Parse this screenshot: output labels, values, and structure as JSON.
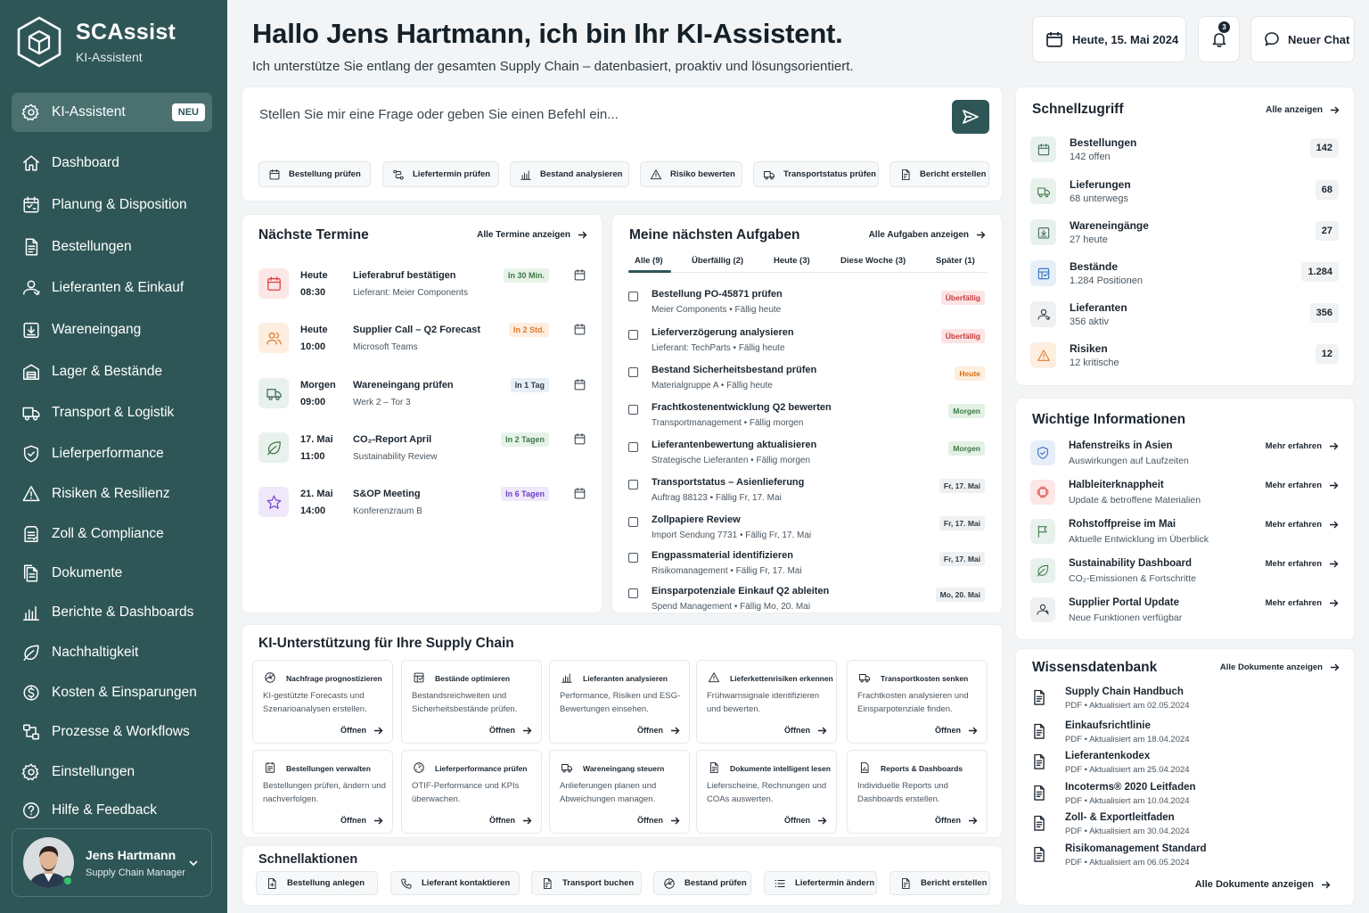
{
  "brand": {
    "name": "SCAssist",
    "subtitle": "KI-Assistent"
  },
  "nav": [
    {
      "label": "KI-Assistent",
      "icon": "gear-sparkle-icon",
      "active": true,
      "badge": "NEU"
    },
    {
      "label": "Dashboard",
      "icon": "home-icon"
    },
    {
      "label": "Planung & Disposition",
      "icon": "calendar-plan-icon"
    },
    {
      "label": "Bestellungen",
      "icon": "document-icon"
    },
    {
      "label": "Lieferanten & Einkauf",
      "icon": "supplier-icon"
    },
    {
      "label": "Wareneingang",
      "icon": "inbound-icon"
    },
    {
      "label": "Lager & Bestände",
      "icon": "warehouse-icon"
    },
    {
      "label": "Transport & Logistik",
      "icon": "truck-icon"
    },
    {
      "label": "Lieferperformance",
      "icon": "shield-check-icon"
    },
    {
      "label": "Risiken & Resilienz",
      "icon": "risk-icon"
    },
    {
      "label": "Zoll & Compliance",
      "icon": "customs-icon"
    },
    {
      "label": "Dokumente",
      "icon": "documents-icon"
    },
    {
      "label": "Berichte & Dashboards",
      "icon": "bar-chart-icon"
    },
    {
      "label": "Nachhaltigkeit",
      "icon": "leaf-icon"
    },
    {
      "label": "Kosten & Einsparungen",
      "icon": "cost-icon"
    },
    {
      "label": "Prozesse & Workflows",
      "icon": "workflow-icon"
    },
    {
      "label": "Einstellungen",
      "icon": "settings-icon"
    },
    {
      "label": "Hilfe & Feedback",
      "icon": "help-icon"
    }
  ],
  "user": {
    "name": "Jens Hartmann",
    "role": "Supply Chain Manager"
  },
  "header": {
    "title": "Hallo Jens Hartmann, ich bin Ihr KI-Assistent.",
    "subtitle": "Ich unterstütze Sie entlang der gesamten Supply Chain – datenbasiert, proaktiv und lösungsorientiert.",
    "date": "Heute, 15. Mai 2024",
    "notification_count": "3",
    "new_chat": "Neuer Chat"
  },
  "prompt": {
    "placeholder": "Stellen Sie mir eine Frage oder geben Sie einen Befehl ein...",
    "chips": [
      "Bestellung prüfen",
      "Liefertermin prüfen",
      "Bestand analysieren",
      "Risiko bewerten",
      "Transportstatus prüfen",
      "Bericht erstellen"
    ]
  },
  "termine": {
    "title": "Nächste Termine",
    "link": "Alle Termine anzeigen",
    "items": [
      {
        "when": "Heute",
        "time": "08:30",
        "title": "Lieferabruf bestätigen",
        "sub": "Lieferant: Meier Components",
        "badge": "In 30 Min.",
        "tone": "green",
        "icon": "calendar-icon"
      },
      {
        "when": "Heute",
        "time": "10:00",
        "title": "Supplier Call – Q2 Forecast",
        "sub": "Microsoft Teams",
        "badge": "In 2 Std.",
        "tone": "orange",
        "icon": "people-icon"
      },
      {
        "when": "Morgen",
        "time": "09:00",
        "title": "Wareneingang prüfen",
        "sub": "Werk 2 – Tor 3",
        "badge": "In 1 Tag",
        "tone": "blue",
        "icon": "truck-icon"
      },
      {
        "when": "17. Mai",
        "time": "11:00",
        "title": "CO₂-Report April",
        "sub": "Sustainability Review",
        "badge": "In 2 Tagen",
        "tone": "green",
        "icon": "leaf-icon"
      },
      {
        "when": "21. Mai",
        "time": "14:00",
        "title": "S&OP Meeting",
        "sub": "Konferenzraum B",
        "badge": "In 6 Tagen",
        "tone": "purple",
        "icon": "star-icon"
      }
    ]
  },
  "aufgaben": {
    "title": "Meine nächsten Aufgaben",
    "link": "Alle Aufgaben anzeigen",
    "tabs": [
      "Alle (9)",
      "Überfällig (2)",
      "Heute (3)",
      "Diese Woche (3)",
      "Später (1)"
    ],
    "items": [
      {
        "title": "Bestellung PO-45871 prüfen",
        "sub": "Meier Components   •   Fällig heute",
        "badge": "Überfällig",
        "tone": "red"
      },
      {
        "title": "Lieferverzögerung analysieren",
        "sub": "Lieferant: TechParts   •   Fällig heute",
        "badge": "Überfällig",
        "tone": "red"
      },
      {
        "title": "Bestand Sicherheitsbestand prüfen",
        "sub": "Materialgruppe A   •   Fällig heute",
        "badge": "Heute",
        "tone": "orange"
      },
      {
        "title": "Frachtkostenentwicklung Q2 bewerten",
        "sub": "Transportmanagement   •   Fällig morgen",
        "badge": "Morgen",
        "tone": "green"
      },
      {
        "title": "Lieferantenbewertung aktualisieren",
        "sub": "Strategische Lieferanten   •   Fällig morgen",
        "badge": "Morgen",
        "tone": "green"
      },
      {
        "title": "Transportstatus – Asienlieferung",
        "sub": "Auftrag 88123   •   Fällig Fr, 17. Mai",
        "badge": "Fr, 17. Mai",
        "tone": "gray"
      },
      {
        "title": "Zollpapiere Review",
        "sub": "Import Sendung 7731   •   Fällig Fr, 17. Mai",
        "badge": "Fr, 17. Mai",
        "tone": "gray"
      },
      {
        "title": "Engpassmaterial identifizieren",
        "sub": "Risikomanagement   •   Fällig Fr, 17. Mai",
        "badge": "Fr, 17. Mai",
        "tone": "gray"
      },
      {
        "title": "Einsparpotenziale Einkauf Q2 ableiten",
        "sub": "Spend Management   •   Fällig Mo, 20. Mai",
        "badge": "Mo, 20. Mai",
        "tone": "gray"
      }
    ]
  },
  "ki": {
    "title": "KI-Unterstützung für Ihre Supply Chain",
    "open_label": "Öffnen",
    "items": [
      {
        "title": "Nachfrage prognostizieren",
        "desc": "KI-gestützte Forecasts und Szenarioanalysen erstellen.",
        "icon": "forecast-icon"
      },
      {
        "title": "Bestände optimieren",
        "desc": "Bestandsreichweiten und Sicherheitsbestände prüfen.",
        "icon": "inventory-icon"
      },
      {
        "title": "Lieferanten analysieren",
        "desc": "Performance, Risiken und ESG-Bewertungen einsehen.",
        "icon": "bar-chart-icon"
      },
      {
        "title": "Lieferkettenrisiken erkennen",
        "desc": "Frühwarnsignale identifizieren und bewerten.",
        "icon": "warning-icon"
      },
      {
        "title": "Transportkosten senken",
        "desc": "Frachtkosten analysieren und Einsparpotenziale finden.",
        "icon": "truck-icon"
      },
      {
        "title": "Bestellungen verwalten",
        "desc": "Bestellungen prüfen, ändern und nachverfolgen.",
        "icon": "order-icon"
      },
      {
        "title": "Lieferperformance prüfen",
        "desc": "OTIF-Performance und KPIs überwachen.",
        "icon": "gauge-icon"
      },
      {
        "title": "Wareneingang steuern",
        "desc": "Anlieferungen planen und Abweichungen managen.",
        "icon": "truck-icon"
      },
      {
        "title": "Dokumente intelligent lesen",
        "desc": "Lieferscheine, Rechnungen und COAs auswerten.",
        "icon": "document-icon"
      },
      {
        "title": "Reports & Dashboards",
        "desc": "Individuelle Reports und Dashboards erstellen.",
        "icon": "report-icon"
      }
    ]
  },
  "schnellaktionen": {
    "title": "Schnellaktionen",
    "items": [
      "Bestellung anlegen",
      "Lieferant kontaktieren",
      "Transport buchen",
      "Bestand prüfen",
      "Liefertermin ändern",
      "Bericht erstellen"
    ]
  },
  "schnellzugriff": {
    "title": "Schnellzugriff",
    "link": "Alle anzeigen",
    "items": [
      {
        "title": "Bestellungen",
        "sub": "142 offen",
        "count": "142",
        "icon": "calendar-icon"
      },
      {
        "title": "Lieferungen",
        "sub": "68 unterwegs",
        "count": "68",
        "icon": "truck-icon"
      },
      {
        "title": "Wareneingänge",
        "sub": "27 heute",
        "count": "27",
        "icon": "inbound-icon"
      },
      {
        "title": "Bestände",
        "sub": "1.284 Positionen",
        "count": "1.284",
        "icon": "inventory-icon"
      },
      {
        "title": "Lieferanten",
        "sub": "356 aktiv",
        "count": "356",
        "icon": "supplier-icon"
      },
      {
        "title": "Risiken",
        "sub": "12 kritische",
        "count": "12",
        "icon": "warning-icon"
      }
    ]
  },
  "wichtig": {
    "title": "Wichtige Informationen",
    "more_label": "Mehr erfahren",
    "items": [
      {
        "title": "Hafenstreiks in Asien",
        "sub": "Auswirkungen auf Laufzeiten",
        "icon": "shield-icon"
      },
      {
        "title": "Halbleiterknappheit",
        "sub": "Update & betroffene Materialien",
        "icon": "chip-icon"
      },
      {
        "title": "Rohstoffpreise im Mai",
        "sub": "Aktuelle Entwicklung im Überblick",
        "icon": "flag-icon"
      },
      {
        "title": "Sustainability Dashboard",
        "sub": "CO₂-Emissionen & Fortschritte",
        "icon": "leaf-icon"
      },
      {
        "title": "Supplier Portal Update",
        "sub": "Neue Funktionen verfügbar",
        "icon": "portal-icon"
      }
    ]
  },
  "wissen": {
    "title": "Wissensdatenbank",
    "link": "Alle Dokumente anzeigen",
    "footer_link": "Alle Dokumente anzeigen",
    "items": [
      {
        "title": "Supply Chain Handbuch",
        "meta": "PDF   •   Aktualisiert am 02.05.2024"
      },
      {
        "title": "Einkaufsrichtlinie",
        "meta": "PDF   •   Aktualisiert am 18.04.2024"
      },
      {
        "title": "Lieferantenkodex",
        "meta": "PDF   •   Aktualisiert am 25.04.2024"
      },
      {
        "title": "Incoterms® 2020 Leitfaden",
        "meta": "PDF   •   Aktualisiert am 10.04.2024"
      },
      {
        "title": "Zoll- & Exportleitfaden",
        "meta": "PDF   •   Aktualisiert am 30.04.2024"
      },
      {
        "title": "Risikomanagement Standard",
        "meta": "PDF   •   Aktualisiert am 06.05.2024"
      }
    ]
  },
  "colors": {
    "sidebar": "#2f5656",
    "accent": "#2f5656",
    "overdue": "#c53a3a",
    "today": "#d2701c",
    "tomorrow": "#3f7a48",
    "later": "#6c3fc4"
  }
}
